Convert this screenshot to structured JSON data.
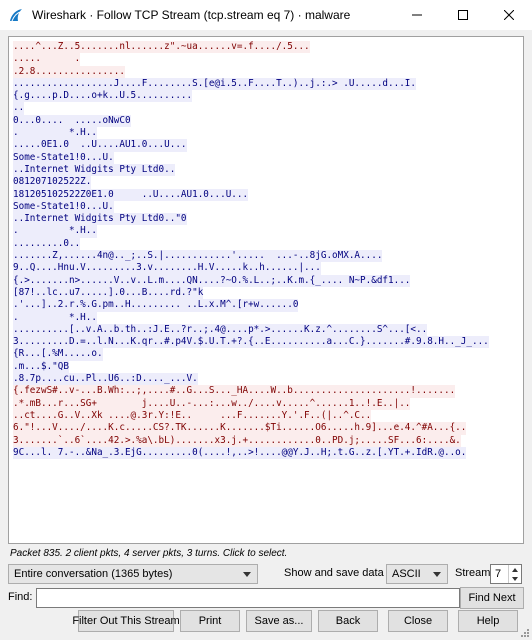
{
  "window": {
    "title": "Wireshark · Follow TCP Stream (tcp.stream eq 7) · malware"
  },
  "colors": {
    "client_bg": "#fbeded",
    "client_fg": "#7f0000",
    "server_bg": "#ededfb",
    "server_fg": "#00007f"
  },
  "stream_lines": [
    {
      "d": "c",
      "t": "....^...Z..5.......nl......z\".~ua......v=.f..../.5..."
    },
    {
      "d": "c",
      "t": ".....      ."
    },
    {
      "d": "c",
      "t": ".2.8................"
    },
    {
      "d": "s",
      "t": "..................J....F........S.[e@i.5..F....T..)..j.:.> .U.....d...I."
    },
    {
      "d": "s",
      "t": "{.g....p.D....o+k..U.5.........."
    },
    {
      "d": "s",
      "t": ".."
    },
    {
      "d": "s",
      "t": "0...0....  .....oNwC0"
    },
    {
      "d": "s",
      "t": ".         *.H.."
    },
    {
      "d": "s",
      "t": ".....0E1.0  ..U....AU1.0...U..."
    },
    {
      "d": "s",
      "t": "Some-State1!0...U."
    },
    {
      "d": "s",
      "t": "..Internet Widgits Pty Ltd0.."
    },
    {
      "d": "s",
      "t": "081207102522Z."
    },
    {
      "d": "s",
      "t": "181205102522Z0E1.0     ..U....AU1.0...U..."
    },
    {
      "d": "s",
      "t": "Some-State1!0...U."
    },
    {
      "d": "s",
      "t": "..Internet Widgits Pty Ltd0..\"0"
    },
    {
      "d": "s",
      "t": ".         *.H.."
    },
    {
      "d": "s",
      "t": ".........0.."
    },
    {
      "d": "s",
      "t": ".......Z,......4n@.._;..S.|............'.....  ...-..8jG.oMX.A...."
    },
    {
      "d": "s",
      "t": "9..Q....Hnu.V.........3.v........H.V.....k..h......|..."
    },
    {
      "d": "s",
      "t": "{.>.......n>......V..v..L.m....QN....?~O.%.L..;..K.m.{_.... N~P.&df1..."
    },
    {
      "d": "s",
      "t": "[87!..lc..u7.....].0...B....rd.?\"k"
    },
    {
      "d": "s",
      "t": ".'...]..2.r.%.G.pm..H......... ..L.x.M^.[r+w......0"
    },
    {
      "d": "s",
      "t": ".         *.H.."
    },
    {
      "d": "s",
      "t": "..........[..v.A..b.th..:J.E..?r..;.4@....p*.>......K.z.^........S^...[<.."
    },
    {
      "d": "s",
      "t": "3.........D.=..l.N...K.qr..#.p4V.$.U.T.+?.{..E..........a...C.}.......#.9.8.H.._J_..."
    },
    {
      "d": "s",
      "t": "{R...[.%M.....o."
    },
    {
      "d": "s",
      "t": ".m...$.\"QB"
    },
    {
      "d": "s",
      "t": ".8.7p....cu..Pl..U6..:D...._...V."
    },
    {
      "d": "c",
      "t": "{.fezwS#..v-...B.Wh:..;,....#..G...S..._HA....W..b.....................!......."
    },
    {
      "d": "c",
      "t": ".*.mB...r...SG+        j....U..-...:...w../....v.....^......1..!.E..|.."
    },
    {
      "d": "c",
      "t": "..ct....G..V..Xk ....@.3r.Y:!E..     ...F.......Y.'.F..(|..^.C.."
    },
    {
      "d": "c",
      "t": "6.\"!...V..../....K.c.....CS?.TK......K.......$Ti......O6.....h.9]...e.4.^#A...{.."
    },
    {
      "d": "c",
      "t": "3.......`..6`....42.>.%a\\.bL).......x3.j.+............0..PD.j;.....SF...6:....&."
    },
    {
      "d": "s",
      "t": "9C...l. 7.-..&Na_.3.EjG.........0(....!,..>!....@@Y.J..H;.t.G..z.[.YT.+.IdR.@..o."
    }
  ],
  "info_text": "Packet 835. 2 client pkts, 4 server pkts, 3 turns. Click to select.",
  "controls": {
    "conversation_select": "Entire conversation (1365 bytes)",
    "show_save_label": "Show and save data as",
    "format_select": "ASCII",
    "stream_label": "Stream",
    "stream_number": "7",
    "find_label": "Find:",
    "find_value": "",
    "find_next": "Find Next"
  },
  "buttons": {
    "filter_out": "Filter Out This Stream",
    "print": "Print",
    "save_as": "Save as...",
    "back": "Back",
    "close": "Close",
    "help": "Help"
  }
}
